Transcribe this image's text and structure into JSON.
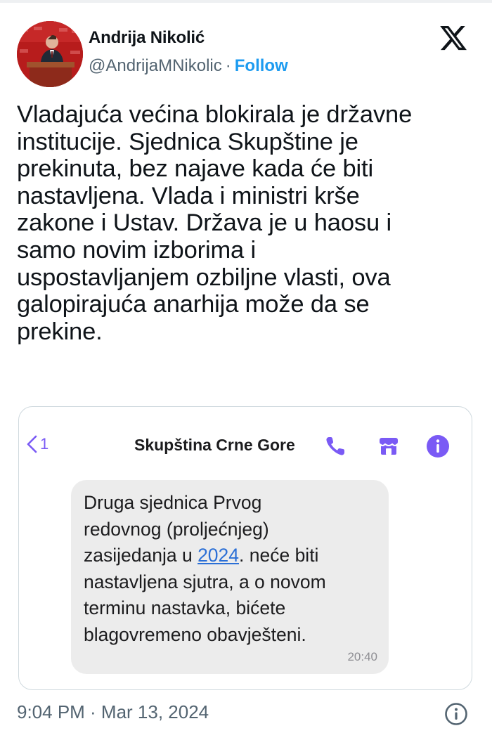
{
  "author": {
    "name": "Andrija Nikolić",
    "handle": "@AndrijaMNikolic",
    "separator": "·",
    "follow_label": "Follow"
  },
  "tweet": {
    "lines": [
      "Vladajuća većina blokirala je državne",
      "institucije. Sjednica Skupštine je",
      "prekinuta, bez najave kada će biti",
      "nastavljena. Vlada i ministri krše",
      "zakone i Ustav. Država je u haosu i",
      "samo novim izborima i",
      "uspostavljanjem ozbiljne vlasti, ova",
      "galopirajuća anarhija može da se",
      "prekine."
    ]
  },
  "sms": {
    "back_count": "1",
    "contact_name": "Skupština Crne Gore",
    "message": {
      "line1": "Druga sjednica Prvog",
      "line2": "redovnog (proljećnjeg)",
      "line3_before": "zasijedanja u ",
      "line3_link": "2024",
      "line3_after": ". neće biti",
      "line4": "nastavljena sjutra, a o novom",
      "line5": "terminu nastavka, bićete",
      "line6": "blagovremeno obavješteni."
    },
    "time": "20:40",
    "icons": [
      "phone-icon",
      "store-icon",
      "info-icon"
    ]
  },
  "footer": {
    "timestamp": "9:04 PM · Mar 13, 2024"
  },
  "colors": {
    "follow": "#1d9bf0",
    "secondary_text": "#536471",
    "sms_accent": "#7a5af5",
    "link": "#2b6fd6",
    "bubble": "#ececec"
  }
}
